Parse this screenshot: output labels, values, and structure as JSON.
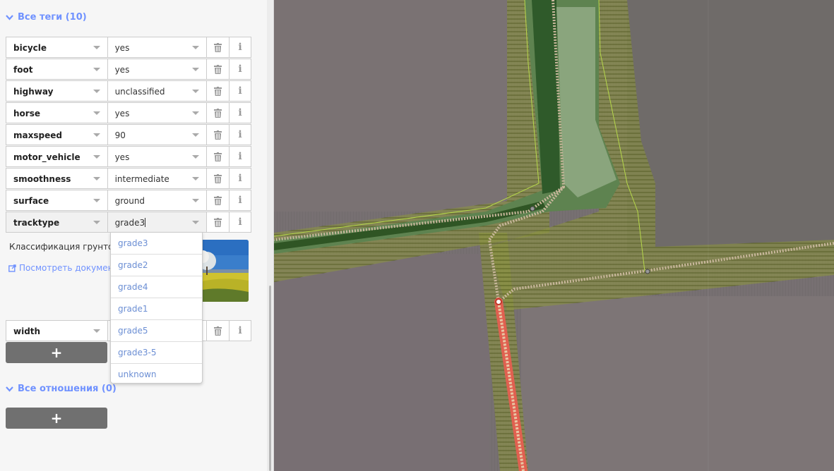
{
  "sidebar": {
    "all_tags": {
      "title": "Все теги (10)"
    },
    "tags": [
      {
        "key": "bicycle",
        "value": "yes"
      },
      {
        "key": "foot",
        "value": "yes"
      },
      {
        "key": "highway",
        "value": "unclassified"
      },
      {
        "key": "horse",
        "value": "yes"
      },
      {
        "key": "maxspeed",
        "value": "90"
      },
      {
        "key": "motor_vehicle",
        "value": "yes"
      },
      {
        "key": "smoothness",
        "value": "intermediate"
      },
      {
        "key": "surface",
        "value": "ground"
      },
      {
        "key": "tracktype",
        "value": "grade3"
      }
    ],
    "width_row": {
      "key": "width",
      "value": ""
    },
    "tag_reference": {
      "description": "Классификация грунтовок",
      "link": "Посмотреть документацию"
    },
    "dropdown_options": [
      "grade3",
      "grade2",
      "grade4",
      "grade1",
      "grade5",
      "grade3-5",
      "unknown"
    ],
    "add_tag_label": "+",
    "all_relations": {
      "title": "Все отношения (0)"
    },
    "add_relation_label": "+"
  },
  "icons": {
    "trash": "trash-icon",
    "info": "info-icon",
    "chevron": "chevron-down-icon",
    "link": "external-link-icon",
    "combo": "combo-arrow-icon"
  },
  "colors": {
    "accent": "#7092ff",
    "add_button": "#707070",
    "highlight_way": "#e06050"
  }
}
